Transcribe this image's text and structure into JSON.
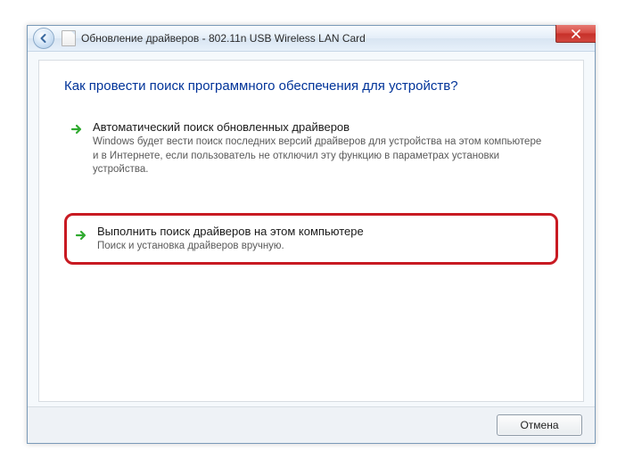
{
  "titlebar": {
    "title": "Обновление драйверов - 802.11n USB Wireless LAN Card"
  },
  "heading": "Как провести поиск программного обеспечения для устройств?",
  "options": {
    "auto": {
      "title": "Автоматический поиск обновленных драйверов",
      "desc": "Windows будет вести поиск последних версий драйверов для устройства на этом компьютере и в Интернете, если пользователь не отключил эту функцию в параметрах установки устройства."
    },
    "manual": {
      "title": "Выполнить поиск драйверов на этом компьютере",
      "desc": "Поиск и установка драйверов вручную."
    }
  },
  "footer": {
    "cancel": "Отмена"
  }
}
